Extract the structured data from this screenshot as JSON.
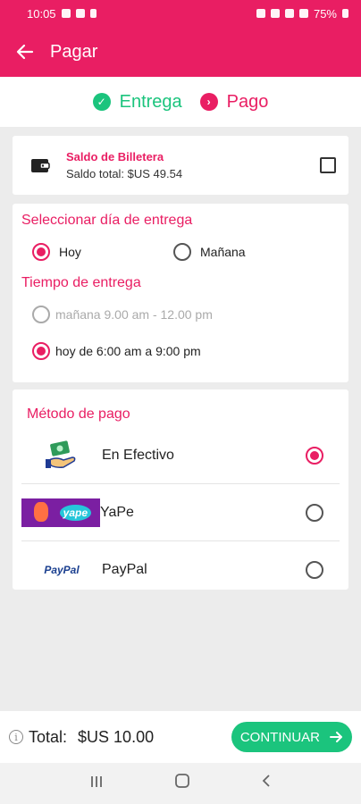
{
  "status_bar": {
    "time": "10:05",
    "battery": "75%"
  },
  "app_bar": {
    "title": "Pagar"
  },
  "steps": [
    {
      "label": "Entrega"
    },
    {
      "label": "Pago"
    }
  ],
  "wallet": {
    "title": "Saldo de Billetera",
    "balance": "Saldo total: $US 49.54"
  },
  "delivery": {
    "day_title": "Seleccionar día de entrega",
    "day_options": [
      "Hoy",
      "Mañana"
    ],
    "time_title": "Tiempo de entrega",
    "time_options": [
      "mañana 9.00 am - 12.00 pm",
      "hoy de 6:00 am a 9:00 pm"
    ]
  },
  "payment": {
    "title": "Método de pago",
    "methods": [
      {
        "label": "En Efectivo",
        "icon": "cash-hand-icon",
        "selected": true
      },
      {
        "label": "YaPe",
        "icon": "yape-logo",
        "logo_text": "yape",
        "selected": false
      },
      {
        "label": "PayPal",
        "icon": "paypal-logo",
        "logo_text": "PayPal",
        "selected": false
      }
    ]
  },
  "footer": {
    "total_label": "Total:",
    "total_value": "$US 10.00",
    "continue_label": "CONTINUAR"
  },
  "colors": {
    "primary": "#e91e63",
    "success": "#1bc47d"
  }
}
